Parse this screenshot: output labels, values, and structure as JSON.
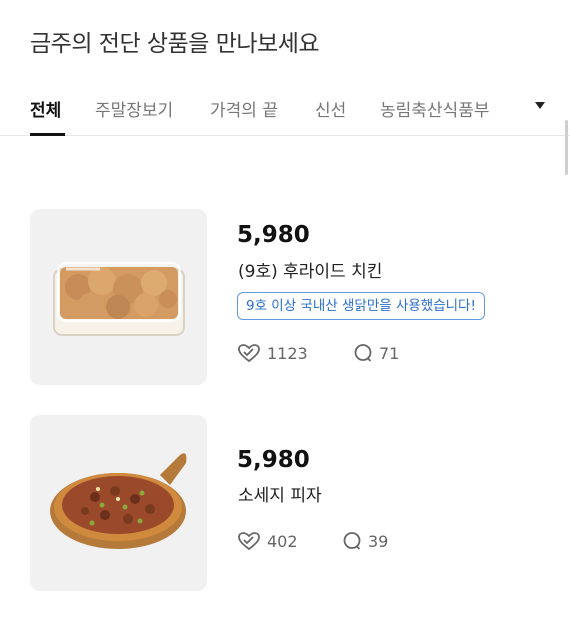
{
  "header": {
    "title": "금주의 전단 상품을 만나보세요"
  },
  "tabs": [
    {
      "label": "전체"
    },
    {
      "label": "주말장보기"
    },
    {
      "label": "가격의 끝"
    },
    {
      "label": "신선"
    },
    {
      "label": "농림축산식품부"
    }
  ],
  "products": [
    {
      "price": "5,980",
      "name": "(9호) 후라이드 치킨",
      "tag": "9호 이상 국내산 생닭만을 사용했습니다!",
      "likes": "1123",
      "comments": "71",
      "image_icon": "fried-chicken-image"
    },
    {
      "price": "5,980",
      "name": "소세지 피자",
      "likes": "402",
      "comments": "39",
      "image_icon": "sausage-pizza-image"
    }
  ],
  "icons": {
    "like": "heart-check-icon",
    "comment": "speech-bubble-icon",
    "more": "caret-down-icon"
  },
  "colors": {
    "tag_border": "#5f9be3",
    "tag_text": "#2c6fd1",
    "active_tab": "#111111"
  }
}
